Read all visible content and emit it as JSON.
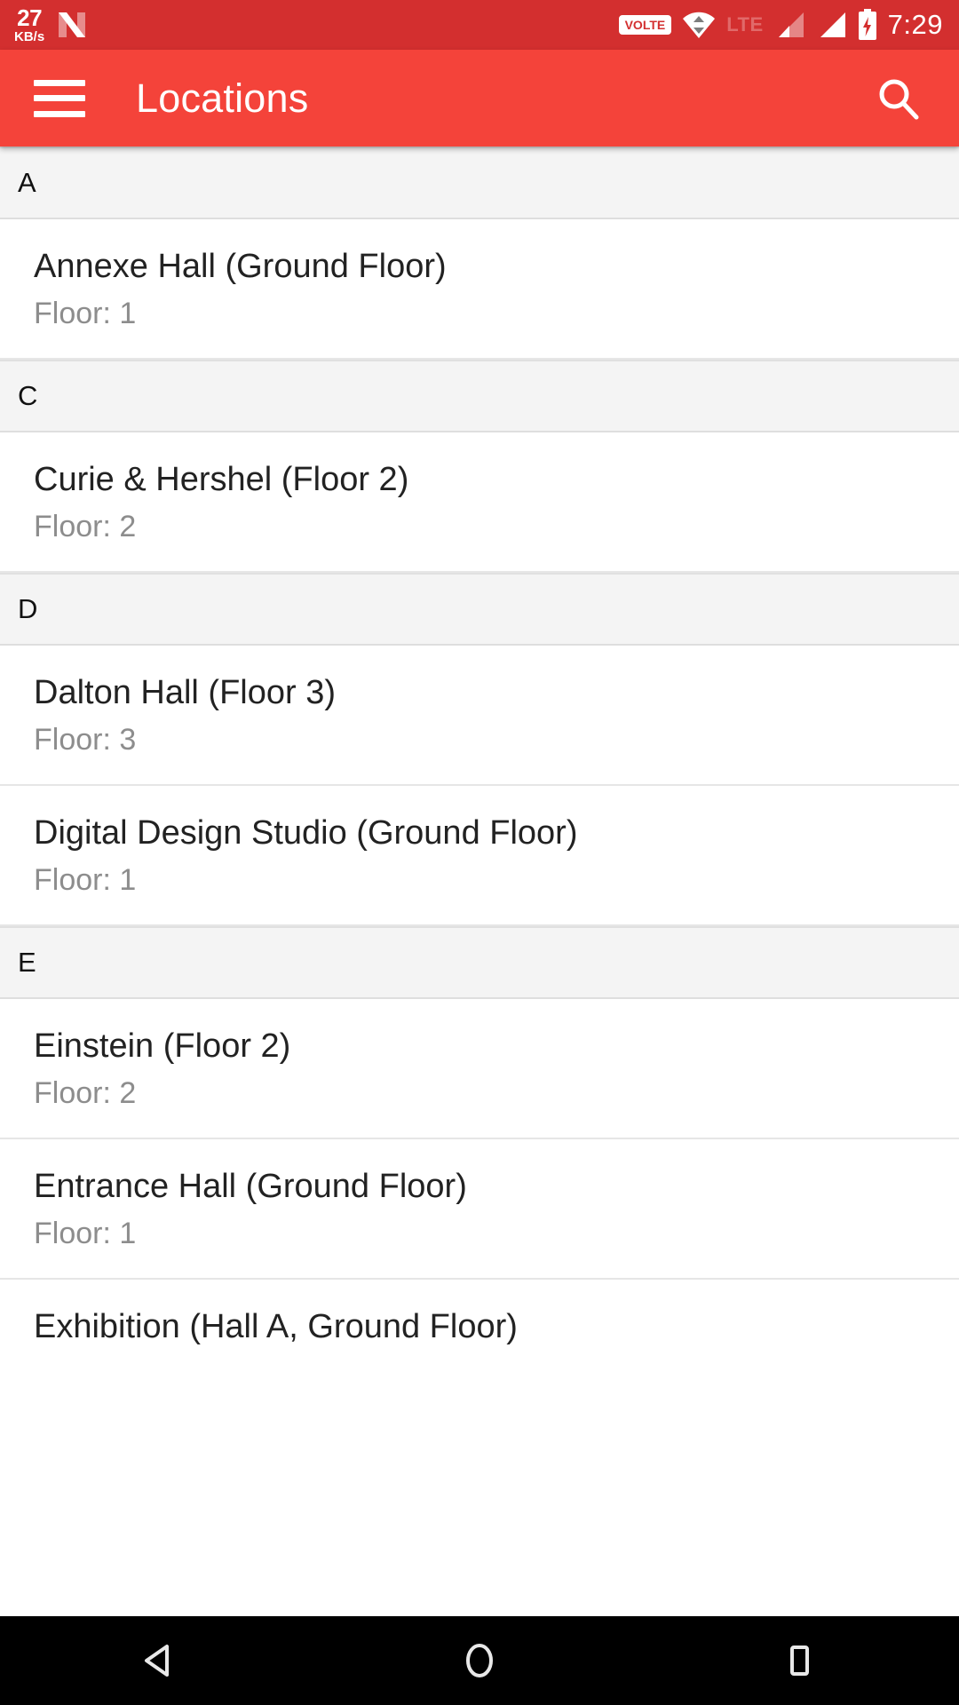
{
  "status_bar": {
    "network_speed_value": "27",
    "network_speed_unit": "KB/s",
    "android_logo": "android-n-logo",
    "volte_label": "VOLTE",
    "wifi_icon": "wifi-icon",
    "lte_label": "LTE",
    "signal_1_icon": "signal-bar-icon",
    "signal_2_icon": "signal-bar-icon",
    "battery_icon": "battery-charging-icon",
    "time": "7:29",
    "background_color": "#D32F2F"
  },
  "app_bar": {
    "menu_icon": "hamburger-menu-icon",
    "title": "Locations",
    "search_icon": "search-icon",
    "background_color": "#F4433A"
  },
  "list": {
    "sections": [
      {
        "letter": "A",
        "items": [
          {
            "title": "Annexe Hall (Ground Floor)",
            "subtitle": "Floor: 1"
          }
        ]
      },
      {
        "letter": "C",
        "items": [
          {
            "title": "Curie & Hershel (Floor 2)",
            "subtitle": "Floor: 2"
          }
        ]
      },
      {
        "letter": "D",
        "items": [
          {
            "title": "Dalton Hall (Floor 3)",
            "subtitle": "Floor: 3"
          },
          {
            "title": "Digital Design Studio (Ground Floor)",
            "subtitle": "Floor: 1"
          }
        ]
      },
      {
        "letter": "E",
        "items": [
          {
            "title": "Einstein (Floor 2)",
            "subtitle": "Floor: 2"
          },
          {
            "title": "Entrance Hall (Ground Floor)",
            "subtitle": "Floor: 1"
          },
          {
            "title": "Exhibition (Hall A, Ground Floor)",
            "subtitle": ""
          }
        ]
      }
    ]
  },
  "nav_bar": {
    "back_icon": "back-triangle-icon",
    "home_icon": "home-circle-icon",
    "recents_icon": "recents-square-icon",
    "background_color": "#000000"
  }
}
